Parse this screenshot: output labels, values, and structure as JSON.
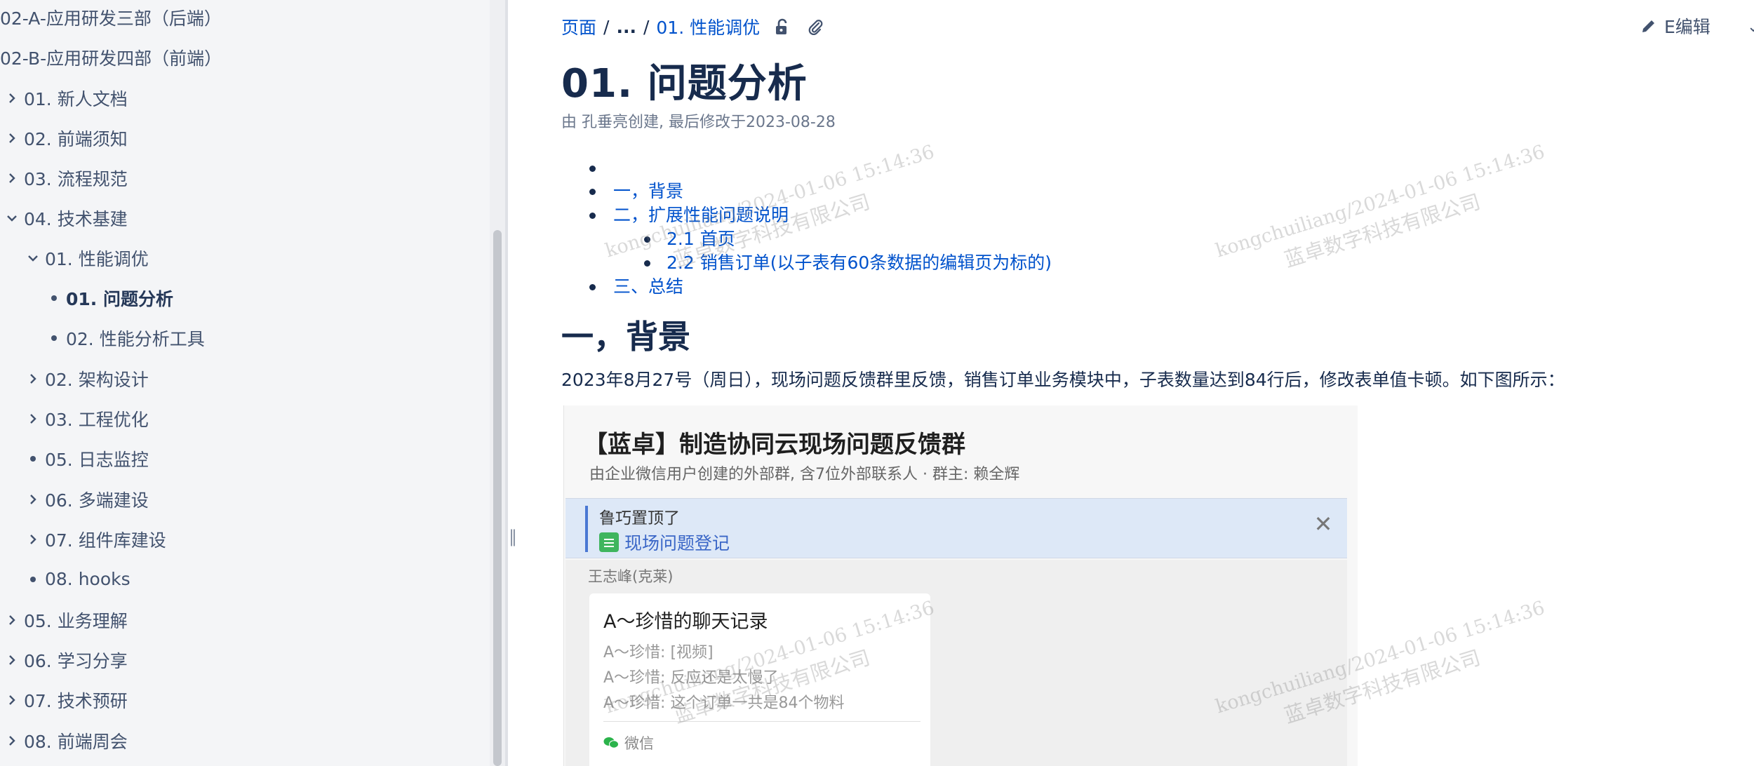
{
  "sidebar": {
    "items": [
      {
        "label": "02-A-应用研发三部（后端）",
        "marker": "none",
        "level": 0
      },
      {
        "label": "02-B-应用研发四部（前端）",
        "marker": "none",
        "level": 0
      },
      {
        "label": "01. 新人文档",
        "marker": "chevron-right",
        "level": 0
      },
      {
        "label": "02. 前端须知",
        "marker": "chevron-right",
        "level": 0
      },
      {
        "label": "03. 流程规范",
        "marker": "chevron-right",
        "level": 0
      },
      {
        "label": "04. 技术基建",
        "marker": "chevron-down",
        "level": 0
      },
      {
        "label": "01. 性能调优",
        "marker": "chevron-down",
        "level": 1
      },
      {
        "label": "01. 问题分析",
        "marker": "dot",
        "level": 2,
        "active": true
      },
      {
        "label": "02. 性能分析工具",
        "marker": "dot",
        "level": 2
      },
      {
        "label": "02. 架构设计",
        "marker": "chevron-right",
        "level": 1
      },
      {
        "label": "03. 工程优化",
        "marker": "chevron-right",
        "level": 1
      },
      {
        "label": "05. 日志监控",
        "marker": "dot",
        "level": 1
      },
      {
        "label": "06. 多端建设",
        "marker": "chevron-right",
        "level": 1
      },
      {
        "label": "07. 组件库建设",
        "marker": "chevron-right",
        "level": 1
      },
      {
        "label": "08. hooks",
        "marker": "dot",
        "level": 1
      },
      {
        "label": "05. 业务理解",
        "marker": "chevron-right",
        "level": 0
      },
      {
        "label": "06. 学习分享",
        "marker": "chevron-right",
        "level": 0
      },
      {
        "label": "07. 技术预研",
        "marker": "chevron-right",
        "level": 0
      },
      {
        "label": "08. 前端周会",
        "marker": "chevron-right",
        "level": 0
      }
    ]
  },
  "breadcrumb": {
    "root": "页面",
    "sep": "/",
    "ellipsis": "...",
    "current": "01. 性能调优"
  },
  "toolbar": {
    "edit_label": "E编辑"
  },
  "page": {
    "title": "01. 问题分析",
    "byline": "由 孔垂亮创建, 最后修改于2023-08-28"
  },
  "toc": {
    "items": [
      "一，背景",
      "二，扩展性能问题说明",
      "2.1 首页",
      "2.2 销售订单(以子表有60条数据的编辑页为标的)",
      "三、总结"
    ]
  },
  "content": {
    "heading": "一，背景",
    "paragraph": "2023年8月27号（周日），现场问题反馈群里反馈，销售订单业务模块中，子表数量达到84行后，修改表单值卡顿。如下图所示："
  },
  "screenshot": {
    "group_title": "【蓝卓】制造协同云现场问题反馈群",
    "group_sub": "由企业微信用户创建的外部群, 含7位外部联系人 · 群主: 赖全辉",
    "pinned_by": "鲁巧置顶了",
    "pinned_link": "现场问题登记",
    "sender": "王志峰(克莱)",
    "card_title": "A～珍惜的聊天记录",
    "card_lines": [
      "A～珍惜: [视频]",
      "A～珍惜: 反应还是太慢了",
      "A～珍惜: 这个订单一共是84个物料"
    ],
    "card_footer": "微信"
  },
  "watermark": {
    "line1": "kongchuiliang/2024-01-06 15:14:36",
    "line2": "蓝卓数字科技有限公司"
  },
  "colors": {
    "link": "#0052cc",
    "sidebar_bg": "#f4f5f7",
    "text": "#172b4d",
    "muted": "#6b778c"
  }
}
